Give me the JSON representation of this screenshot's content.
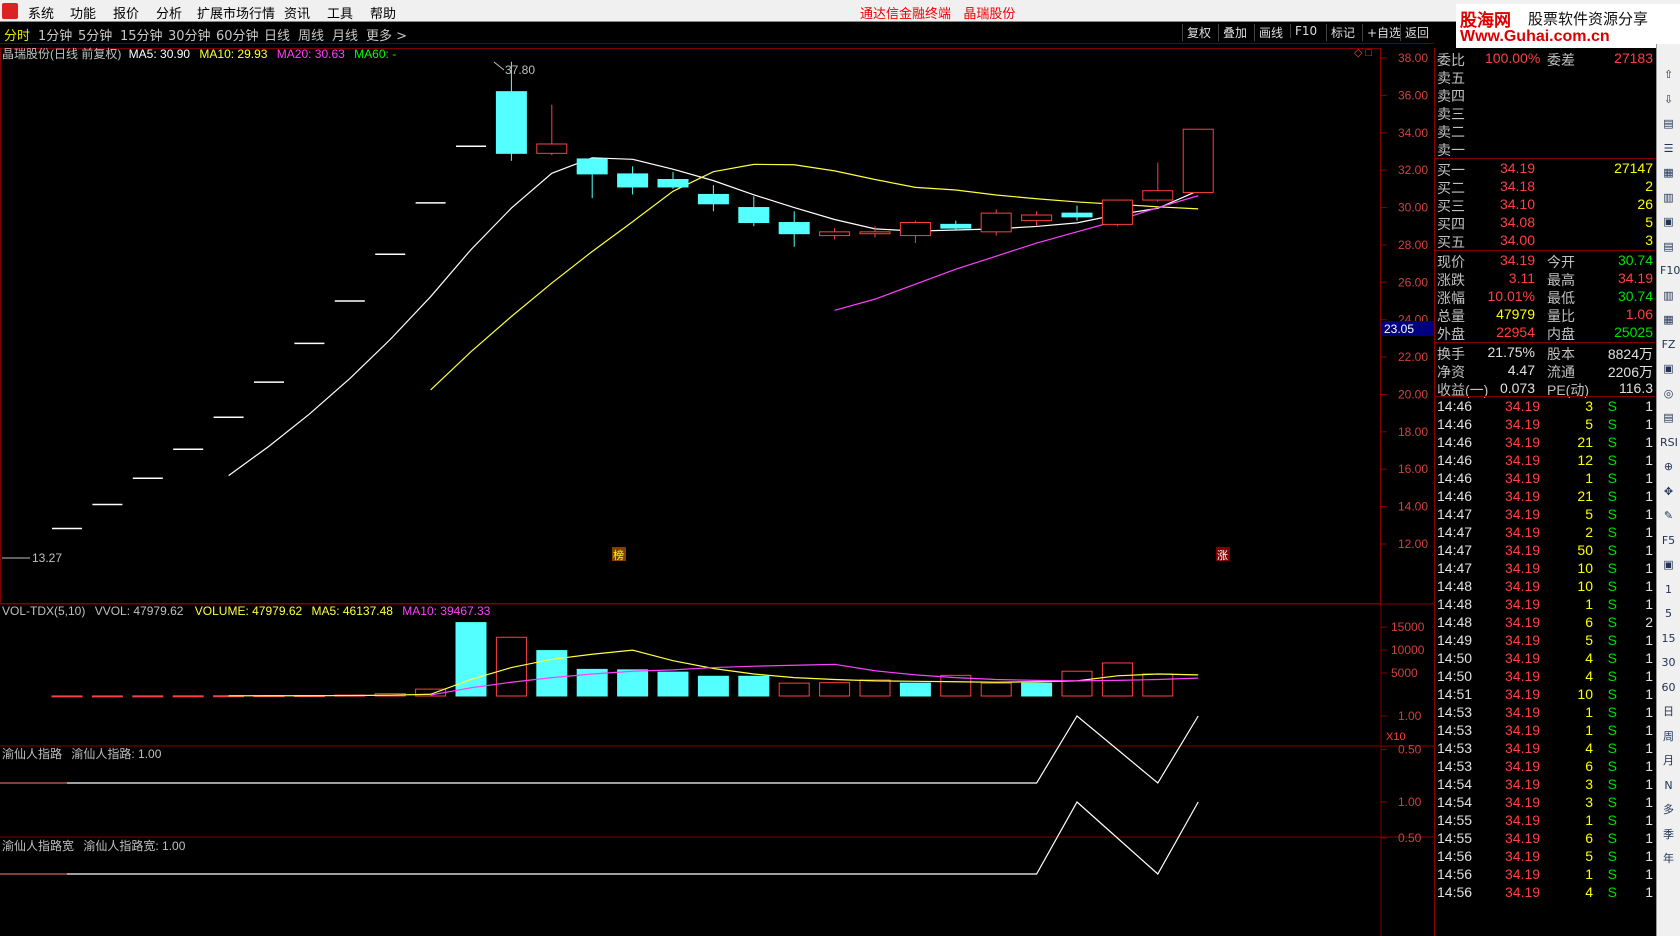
{
  "menu": [
    "系统",
    "功能",
    "报价",
    "分析",
    "扩展市场行情",
    "资讯",
    "工具",
    "帮助"
  ],
  "app_title": "通达信金融终端",
  "stock_title": "晶瑞股份",
  "tabs": [
    "分时",
    "1分钟",
    "5分钟",
    "15分钟",
    "30分钟",
    "60分钟",
    "日线",
    "周线",
    "月线",
    "更多 >"
  ],
  "right_buttons": [
    "复权",
    "叠加",
    "画线",
    "F10",
    "标记",
    "+自选",
    "返回"
  ],
  "banner": {
    "brand": "股海网",
    "slogan": "股票软件资源分享",
    "url": "Www.Guhai.com.cn"
  },
  "main_legend": {
    "name": "晶瑞股份(日线 前复权)",
    "ma5": "MA5: 30.90",
    "ma10": "MA10: 29.93",
    "ma20": "MA20: 30.63",
    "ma60": "MA60: -"
  },
  "vol_legend": {
    "name": "VOL-TDX(5,10)",
    "vvol": "VVOL: 47979.62",
    "volume": "VOLUME: 47979.62",
    "ma5": "MA5: 46137.48",
    "ma10": "MA10: 39467.33"
  },
  "ind1_legend": {
    "name": "渝仙人指路",
    "value": "渝仙人指路: 1.00"
  },
  "ind2_legend": {
    "name": "渝仙人指路宽",
    "value": "渝仙人指路宽: 1.00"
  },
  "price_markers": {
    "high": "37.80",
    "low": "13.27",
    "cursor": "23.05",
    "badge1": "榜",
    "badge2": "涨",
    "vol_unit": "X10"
  },
  "price_axis": [
    "38.00",
    "36.00",
    "34.00",
    "32.00",
    "30.00",
    "28.00",
    "26.00",
    "24.00",
    "22.00",
    "20.00",
    "18.00",
    "16.00",
    "14.00",
    "12.00"
  ],
  "vol_axis": [
    "15000",
    "10000",
    "5000"
  ],
  "ind_axis": [
    "1.00",
    "0.50"
  ],
  "colors": {
    "up": "#ff4040",
    "down": "#54ffff",
    "ma5": "#ffffff",
    "ma10": "#ffff40",
    "ma20": "#ff40ff",
    "grid": "#800000"
  },
  "chart_data": {
    "type": "candlestick",
    "candles": [
      {
        "o": 12.83,
        "h": 12.83,
        "l": 12.83,
        "c": 12.83
      },
      {
        "o": 14.11,
        "h": 14.11,
        "l": 14.11,
        "c": 14.11
      },
      {
        "o": 15.52,
        "h": 15.52,
        "l": 15.52,
        "c": 15.52
      },
      {
        "o": 17.07,
        "h": 17.07,
        "l": 17.07,
        "c": 17.07
      },
      {
        "o": 18.78,
        "h": 18.78,
        "l": 18.78,
        "c": 18.78
      },
      {
        "o": 20.66,
        "h": 20.66,
        "l": 20.66,
        "c": 20.66
      },
      {
        "o": 22.73,
        "h": 22.73,
        "l": 22.73,
        "c": 22.73
      },
      {
        "o": 25.0,
        "h": 25.0,
        "l": 25.0,
        "c": 25.0
      },
      {
        "o": 27.5,
        "h": 27.5,
        "l": 27.5,
        "c": 27.5
      },
      {
        "o": 30.25,
        "h": 30.25,
        "l": 30.25,
        "c": 30.25
      },
      {
        "o": 33.28,
        "h": 33.28,
        "l": 33.28,
        "c": 33.28
      },
      {
        "o": 36.2,
        "h": 37.8,
        "l": 32.5,
        "c": 32.9
      },
      {
        "o": 32.9,
        "h": 35.5,
        "l": 32.8,
        "c": 33.4
      },
      {
        "o": 32.6,
        "h": 32.7,
        "l": 30.5,
        "c": 31.8
      },
      {
        "o": 31.8,
        "h": 32.2,
        "l": 30.7,
        "c": 31.1
      },
      {
        "o": 31.5,
        "h": 31.9,
        "l": 31.0,
        "c": 31.1
      },
      {
        "o": 30.7,
        "h": 31.2,
        "l": 29.8,
        "c": 30.2
      },
      {
        "o": 30.0,
        "h": 30.6,
        "l": 29.0,
        "c": 29.2
      },
      {
        "o": 29.2,
        "h": 29.8,
        "l": 27.9,
        "c": 28.6
      },
      {
        "o": 28.5,
        "h": 28.9,
        "l": 28.3,
        "c": 28.7
      },
      {
        "o": 28.6,
        "h": 29.0,
        "l": 28.4,
        "c": 28.7
      },
      {
        "o": 28.5,
        "h": 29.3,
        "l": 28.1,
        "c": 29.2
      },
      {
        "o": 29.1,
        "h": 29.3,
        "l": 28.8,
        "c": 28.9
      },
      {
        "o": 28.7,
        "h": 29.9,
        "l": 28.5,
        "c": 29.7
      },
      {
        "o": 29.3,
        "h": 29.8,
        "l": 29.0,
        "c": 29.6
      },
      {
        "o": 29.7,
        "h": 30.1,
        "l": 29.3,
        "c": 29.5
      },
      {
        "o": 29.1,
        "h": 30.4,
        "l": 29.0,
        "c": 30.4
      },
      {
        "o": 30.4,
        "h": 32.4,
        "l": 30.3,
        "c": 30.9
      },
      {
        "o": 30.8,
        "h": 34.19,
        "l": 30.8,
        "c": 34.19
      }
    ],
    "ma5": [
      null,
      null,
      null,
      null,
      15.66,
      17.23,
      18.95,
      20.85,
      22.94,
      25.23,
      27.75,
      29.97,
      31.83,
      32.66,
      32.58,
      32.05,
      31.44,
      30.68,
      30.0,
      29.36,
      28.86,
      28.74,
      28.8,
      28.86,
      28.99,
      29.18,
      29.62,
      29.96,
      30.9
    ],
    "ma10": [
      null,
      null,
      null,
      null,
      null,
      null,
      null,
      null,
      null,
      20.24,
      22.29,
      24.17,
      25.96,
      27.65,
      29.24,
      30.87,
      31.92,
      32.31,
      32.29,
      31.96,
      31.5,
      31.08,
      30.94,
      30.67,
      30.47,
      30.3,
      30.17,
      30.04,
      29.93
    ],
    "ma20": [
      null,
      null,
      null,
      null,
      null,
      null,
      null,
      null,
      null,
      null,
      null,
      null,
      null,
      null,
      null,
      null,
      null,
      null,
      null,
      24.5,
      25.1,
      25.9,
      26.7,
      27.4,
      28.1,
      28.7,
      29.3,
      30.0,
      30.63
    ],
    "volume": [
      20,
      20,
      30,
      40,
      60,
      80,
      100,
      200,
      500,
      1500,
      16000,
      12800,
      9900,
      5800,
      5700,
      5200,
      4300,
      4300,
      2800,
      2900,
      3500,
      2800,
      4500,
      2800,
      2800,
      5400,
      7200,
      4800
    ],
    "volume_up": [
      1,
      1,
      1,
      1,
      1,
      1,
      1,
      1,
      1,
      1,
      0,
      1,
      0,
      0,
      0,
      0,
      0,
      0,
      1,
      1,
      1,
      0,
      1,
      1,
      0,
      1,
      1,
      1
    ],
    "vol_ma5": [
      null,
      null,
      null,
      null,
      40,
      50,
      60,
      90,
      180,
      380,
      3600,
      6200,
      8000,
      9100,
      10000,
      7700,
      6000,
      4800,
      4000,
      3600,
      3300,
      3200,
      3100,
      3000,
      3100,
      3300,
      4400,
      4800,
      4600
    ],
    "vol_ma10": [
      null,
      null,
      null,
      null,
      null,
      null,
      null,
      null,
      null,
      200,
      1800,
      3000,
      4000,
      4800,
      5400,
      5700,
      6200,
      6500,
      6700,
      6900,
      5500,
      4600,
      4000,
      3600,
      3400,
      3300,
      3400,
      3600,
      3900
    ],
    "indicator": [
      0,
      0,
      0,
      0,
      0,
      0,
      0,
      0,
      0,
      0,
      0,
      0,
      0,
      0,
      0,
      0,
      0,
      0,
      0,
      0,
      0,
      0,
      0,
      0,
      0,
      1,
      0.5,
      0,
      1
    ],
    "price_ylim": [
      12,
      38
    ],
    "vol_ylim": [
      0,
      17000
    ]
  },
  "order_book": {
    "weibi": {
      "label": "委比",
      "value": "100.00%"
    },
    "weicha": {
      "label": "委差",
      "value": "27183"
    },
    "asks": [
      {
        "label": "卖五",
        "price": "",
        "vol": ""
      },
      {
        "label": "卖四",
        "price": "",
        "vol": ""
      },
      {
        "label": "卖三",
        "price": "",
        "vol": ""
      },
      {
        "label": "卖二",
        "price": "",
        "vol": ""
      },
      {
        "label": "卖一",
        "price": "",
        "vol": ""
      }
    ],
    "bids": [
      {
        "label": "买一",
        "price": "34.19",
        "vol": "27147"
      },
      {
        "label": "买二",
        "price": "34.18",
        "vol": "2"
      },
      {
        "label": "买三",
        "price": "34.10",
        "vol": "26"
      },
      {
        "label": "买四",
        "price": "34.08",
        "vol": "5"
      },
      {
        "label": "买五",
        "price": "34.00",
        "vol": "3"
      }
    ],
    "stats": [
      {
        "l1": "现价",
        "v1": "34.19",
        "l2": "今开",
        "v2": "30.74",
        "c1": "red",
        "c2": "grn"
      },
      {
        "l1": "涨跌",
        "v1": "3.11",
        "l2": "最高",
        "v2": "34.19",
        "c1": "red",
        "c2": "red"
      },
      {
        "l1": "涨幅",
        "v1": "10.01%",
        "l2": "最低",
        "v2": "30.74",
        "c1": "red",
        "c2": "grn"
      },
      {
        "l1": "总量",
        "v1": "47979",
        "l2": "量比",
        "v2": "1.06",
        "c1": "yel",
        "c2": "red"
      },
      {
        "l1": "外盘",
        "v1": "22954",
        "l2": "内盘",
        "v2": "25025",
        "c1": "red",
        "c2": "grn"
      }
    ],
    "stats2": [
      {
        "l1": "换手",
        "v1": "21.75%",
        "l2": "股本",
        "v2": "8824万"
      },
      {
        "l1": "净资",
        "v1": "4.47",
        "l2": "流通",
        "v2": "2206万"
      },
      {
        "l1": "收益(一)",
        "v1": "0.073",
        "l2": "PE(动)",
        "v2": "116.3"
      }
    ],
    "ticks": [
      {
        "t": "14:46",
        "p": "34.19",
        "v": "3",
        "s": "S",
        "n": "1"
      },
      {
        "t": "14:46",
        "p": "34.19",
        "v": "5",
        "s": "S",
        "n": "1"
      },
      {
        "t": "14:46",
        "p": "34.19",
        "v": "21",
        "s": "S",
        "n": "1"
      },
      {
        "t": "14:46",
        "p": "34.19",
        "v": "12",
        "s": "S",
        "n": "1"
      },
      {
        "t": "14:46",
        "p": "34.19",
        "v": "1",
        "s": "S",
        "n": "1"
      },
      {
        "t": "14:46",
        "p": "34.19",
        "v": "21",
        "s": "S",
        "n": "1"
      },
      {
        "t": "14:47",
        "p": "34.19",
        "v": "5",
        "s": "S",
        "n": "1"
      },
      {
        "t": "14:47",
        "p": "34.19",
        "v": "2",
        "s": "S",
        "n": "1"
      },
      {
        "t": "14:47",
        "p": "34.19",
        "v": "50",
        "s": "S",
        "n": "1"
      },
      {
        "t": "14:47",
        "p": "34.19",
        "v": "10",
        "s": "S",
        "n": "1"
      },
      {
        "t": "14:48",
        "p": "34.19",
        "v": "10",
        "s": "S",
        "n": "1"
      },
      {
        "t": "14:48",
        "p": "34.19",
        "v": "1",
        "s": "S",
        "n": "1"
      },
      {
        "t": "14:48",
        "p": "34.19",
        "v": "6",
        "s": "S",
        "n": "2"
      },
      {
        "t": "14:49",
        "p": "34.19",
        "v": "5",
        "s": "S",
        "n": "1"
      },
      {
        "t": "14:50",
        "p": "34.19",
        "v": "4",
        "s": "S",
        "n": "1"
      },
      {
        "t": "14:50",
        "p": "34.19",
        "v": "4",
        "s": "S",
        "n": "1"
      },
      {
        "t": "14:51",
        "p": "34.19",
        "v": "10",
        "s": "S",
        "n": "1"
      },
      {
        "t": "14:53",
        "p": "34.19",
        "v": "1",
        "s": "S",
        "n": "1"
      },
      {
        "t": "14:53",
        "p": "34.19",
        "v": "1",
        "s": "S",
        "n": "1"
      },
      {
        "t": "14:53",
        "p": "34.19",
        "v": "4",
        "s": "S",
        "n": "1"
      },
      {
        "t": "14:53",
        "p": "34.19",
        "v": "6",
        "s": "S",
        "n": "1"
      },
      {
        "t": "14:54",
        "p": "34.19",
        "v": "3",
        "s": "S",
        "n": "1"
      },
      {
        "t": "14:54",
        "p": "34.19",
        "v": "3",
        "s": "S",
        "n": "1"
      },
      {
        "t": "14:55",
        "p": "34.19",
        "v": "1",
        "s": "S",
        "n": "1"
      },
      {
        "t": "14:55",
        "p": "34.19",
        "v": "6",
        "s": "S",
        "n": "1"
      },
      {
        "t": "14:56",
        "p": "34.19",
        "v": "5",
        "s": "S",
        "n": "1"
      },
      {
        "t": "14:56",
        "p": "34.19",
        "v": "1",
        "s": "S",
        "n": "1"
      },
      {
        "t": "14:56",
        "p": "34.19",
        "v": "4",
        "s": "S",
        "n": "1"
      }
    ]
  },
  "side_tools": [
    "⇧",
    "⇩",
    "▤",
    "☰",
    "▦",
    "▥",
    "▣",
    "▤",
    "F10",
    "▥",
    "▦",
    "FZ",
    "▣",
    "◎",
    "▤",
    "RSI",
    "⊕",
    "✥",
    "✎",
    "F5",
    "▣",
    "1",
    "5",
    "15",
    "30",
    "60",
    "日",
    "周",
    "月",
    "N",
    "多",
    "季",
    "年"
  ]
}
